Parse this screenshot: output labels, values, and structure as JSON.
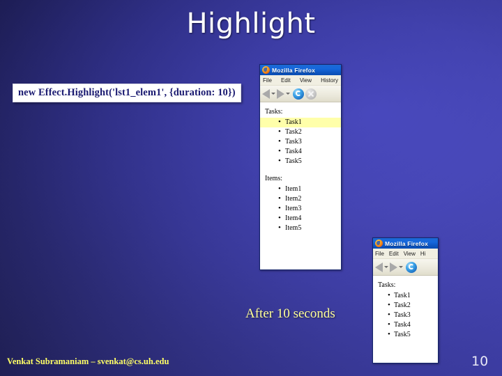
{
  "slide": {
    "title": "Highlight",
    "page_number": "10",
    "footer_credit": "Venkat Subramaniam – svenkat@cs.uh.edu",
    "after_caption": "After 10 seconds",
    "accent_colors": {
      "background_dark": "#0b0b1e",
      "background_blue": "#2d2d8c",
      "title_text": "#ffffff",
      "caption_yellow": "#ffff99",
      "footer_yellow": "#ffff66",
      "code_text": "#191970",
      "highlight_yellow": "#ffffaa"
    }
  },
  "code_callout": {
    "text": "new Effect.Highlight('lst1_elem1', {duration: 10})"
  },
  "browser_windows": [
    {
      "title": "Mozilla Firefox",
      "logo_icon": "firefox-logo-icon",
      "menus": [
        "File",
        "Edit",
        "View",
        "History"
      ],
      "toolbar_buttons": [
        "back-icon",
        "back-dropdown-caret-icon",
        "forward-icon",
        "forward-dropdown-caret-icon",
        "reload-icon",
        "stop-icon"
      ],
      "sections": [
        {
          "heading": "Tasks:",
          "items": [
            {
              "label": "Task1",
              "highlighted": true
            },
            {
              "label": "Task2",
              "highlighted": false
            },
            {
              "label": "Task3",
              "highlighted": false
            },
            {
              "label": "Task4",
              "highlighted": false
            },
            {
              "label": "Task5",
              "highlighted": false
            }
          ]
        },
        {
          "heading": "Items:",
          "items": [
            {
              "label": "Item1",
              "highlighted": false
            },
            {
              "label": "Item2",
              "highlighted": false
            },
            {
              "label": "Item3",
              "highlighted": false
            },
            {
              "label": "Item4",
              "highlighted": false
            },
            {
              "label": "Item5",
              "highlighted": false
            }
          ]
        }
      ]
    },
    {
      "title": "Mozilla Firefox",
      "logo_icon": "firefox-logo-icon",
      "menus": [
        "File",
        "Edit",
        "View",
        "Hi"
      ],
      "toolbar_buttons": [
        "back-icon",
        "back-dropdown-caret-icon",
        "forward-icon",
        "forward-dropdown-caret-icon",
        "reload-icon"
      ],
      "sections": [
        {
          "heading": "Tasks:",
          "items": [
            {
              "label": "Task1",
              "highlighted": false
            },
            {
              "label": "Task2",
              "highlighted": false
            },
            {
              "label": "Task3",
              "highlighted": false
            },
            {
              "label": "Task4",
              "highlighted": false
            },
            {
              "label": "Task5",
              "highlighted": false
            }
          ]
        }
      ]
    }
  ]
}
